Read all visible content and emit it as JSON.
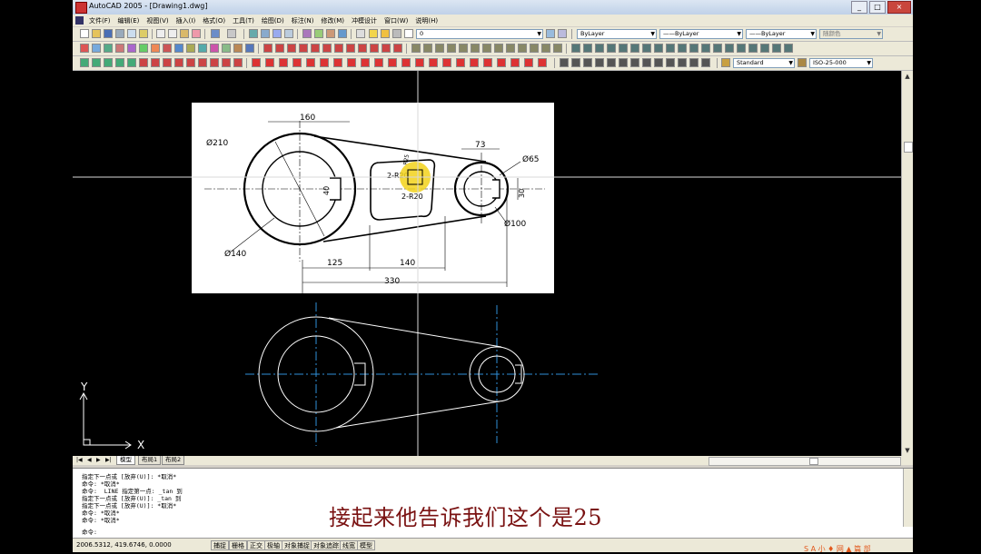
{
  "window": {
    "title": "AutoCAD 2005 - [Drawing1.dwg]",
    "controls": [
      "_",
      "□",
      "×"
    ]
  },
  "menu": [
    "文件(F)",
    "编辑(E)",
    "视图(V)",
    "插入(I)",
    "格式(O)",
    "工具(T)",
    "绘图(D)",
    "标注(N)",
    "修改(M)",
    "冲模设计",
    "窗口(W)",
    "说明(H)"
  ],
  "toolbar": {
    "layer_value": "0",
    "color_value": "ByLayer",
    "linetype_value": "ByLayer",
    "lineweight_value": "ByLayer",
    "plotstyle_value": "随颜色",
    "textstyle_value": "Standard",
    "dimstyle_value": "ISO-25-000"
  },
  "drawing": {
    "background": "#000000",
    "crosshair_color": "#d8d8d8",
    "center_line_color": "#2f8fd8",
    "highlight_color": "#f2d21b",
    "ucs": {
      "x_label": "X",
      "y_label": "Y"
    },
    "ref_image_labels": {
      "d210": "Ø210",
      "d140": "Ø140",
      "d65": "Ø65",
      "d100": "Ø100",
      "dim160": "160",
      "dim73": "73",
      "dim40": "40",
      "dim30": "30",
      "dim125": "125",
      "dim140": "140",
      "dim330": "330",
      "r25": "R25",
      "r20a": "2-R20",
      "r20b": "2-R20"
    }
  },
  "tabs": [
    {
      "label": "模型",
      "active": true
    },
    {
      "label": "布局1",
      "active": false
    },
    {
      "label": "布局2",
      "active": false
    }
  ],
  "command_lines": [
    "指定下一点或 [放弃(U)]: *取消*",
    "命令: *取消*",
    "命令:  LINE 指定第一点: _tan 到",
    "指定下一点或 [放弃(U)]: _tan 到",
    "指定下一点或 [放弃(U)]: *取消*",
    "命令: *取消*",
    "命令: *取消*"
  ],
  "command_prompt": "命令:",
  "subtitle": "接起来他告诉我们这个是25",
  "status": {
    "coords": "2006.5312,  419.6746,  0.0000",
    "buttons": [
      "捕捉",
      "栅格",
      "正交",
      "极轴",
      "对象捕捉",
      "对象追踪",
      "线宽",
      "模型"
    ]
  },
  "watermark": "S A 小 ♦ 网 ▲ 篇 部"
}
